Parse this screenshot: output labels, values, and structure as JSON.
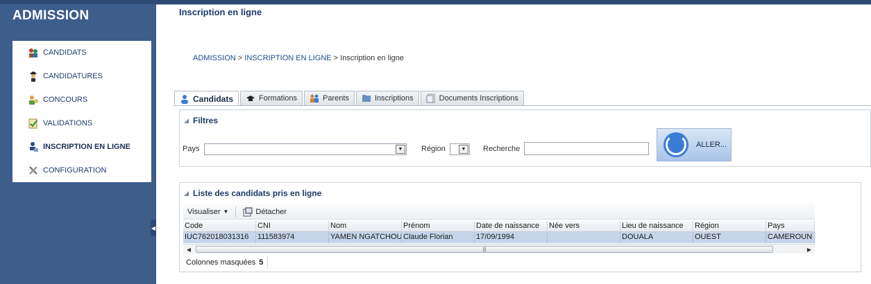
{
  "sidebar": {
    "title": "ADMISSION",
    "items": [
      {
        "label": "CANDIDATS",
        "icon": "candidates-icon"
      },
      {
        "label": "CANDIDATURES",
        "icon": "graduate-icon"
      },
      {
        "label": "CONCOURS",
        "icon": "contest-icon"
      },
      {
        "label": "VALIDATIONS",
        "icon": "checklist-icon"
      },
      {
        "label": "INSCRIPTION EN LIGNE",
        "icon": "online-registration-icon",
        "active": true
      },
      {
        "label": "CONFIGURATION",
        "icon": "tools-icon"
      }
    ]
  },
  "page": {
    "title": "Inscription en ligne",
    "breadcrumb": [
      "ADMISSION",
      "INSCRIPTION EN LIGNE",
      "Inscription en ligne"
    ],
    "breadcrumb_sep": ">"
  },
  "tabs": [
    {
      "label": "Candidats",
      "active": true
    },
    {
      "label": "Formations"
    },
    {
      "label": "Parents"
    },
    {
      "label": "Inscriptions"
    },
    {
      "label": "Documents Inscriptions"
    }
  ],
  "filters": {
    "title": "Filtres",
    "pays_label": "Pays",
    "pays_value": "",
    "region_label": "Région",
    "region_value": "",
    "recherche_label": "Recherche",
    "recherche_value": "",
    "go_button": "ALLER..."
  },
  "list": {
    "title": "Liste des candidats pris en ligne",
    "visualiser": "Visualiser",
    "detacher": "Détacher",
    "columns": [
      "Code",
      "CNI",
      "Nom",
      "Prénom",
      "Date de naissance",
      "Née vers",
      "Lieu de naissance",
      "Région",
      "Pays"
    ],
    "rows": [
      [
        "IUC762018031316",
        "111583974",
        "YAMEN NGATCHOU",
        "Claude Florian",
        "17/09/1994",
        "",
        "DOUALA",
        "OUEST",
        "CAMEROUN"
      ]
    ],
    "hidden_columns_label": "Colonnes masquées",
    "hidden_columns_count": "5"
  },
  "colors": {
    "sidebar": "#3d5d8b",
    "accent": "#1d3a6a",
    "selected_row": "#c6d5ea"
  }
}
